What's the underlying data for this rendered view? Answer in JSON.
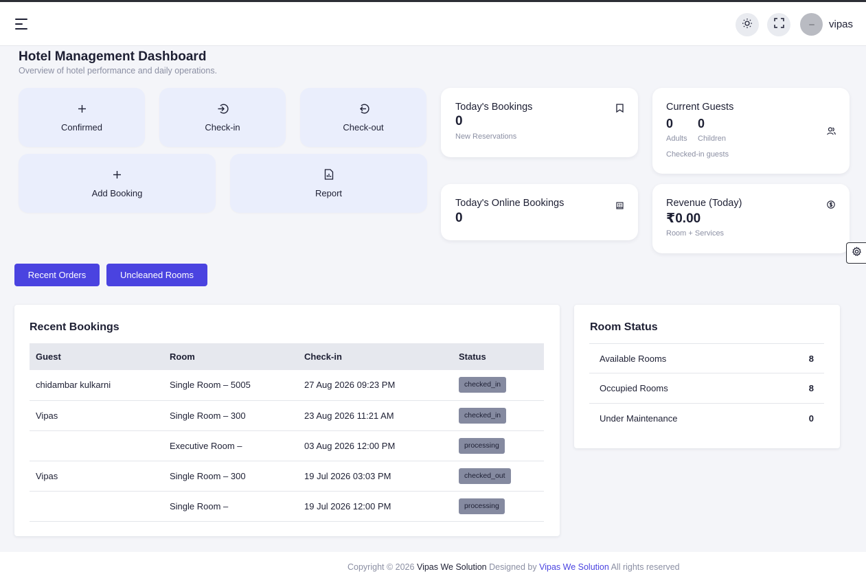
{
  "header": {
    "username": "vipas"
  },
  "page": {
    "title": "Hotel Management Dashboard",
    "subtitle": "Overview of hotel performance and daily operations."
  },
  "quick_actions": [
    {
      "label": "Confirmed",
      "icon": "plus-icon"
    },
    {
      "label": "Check-in",
      "icon": "login-icon"
    },
    {
      "label": "Check-out",
      "icon": "logout-icon"
    },
    {
      "label": "Add Booking",
      "icon": "plus-icon"
    },
    {
      "label": "Report",
      "icon": "report-icon"
    }
  ],
  "stats": {
    "todays_bookings": {
      "title": "Today's Bookings",
      "value": "0",
      "caption": "New Reservations",
      "icon": "bookmark-icon"
    },
    "current_guests": {
      "title": "Current Guests",
      "adults_value": "0",
      "adults_label": "Adults",
      "children_value": "0",
      "children_label": "Children",
      "caption": "Checked-in guests",
      "icon": "users-icon"
    },
    "online_bookings": {
      "title": "Today's Online Bookings",
      "value": "0",
      "icon": "building-icon"
    },
    "revenue": {
      "title": "Revenue (Today)",
      "value": "₹0.00",
      "caption": "Room + Services",
      "icon": "dollar-icon"
    }
  },
  "buttons": {
    "recent_orders": "Recent Orders",
    "uncleaned_rooms": "Uncleaned Rooms"
  },
  "recent_bookings": {
    "title": "Recent Bookings",
    "columns": [
      "Guest",
      "Room",
      "Check-in",
      "Status"
    ],
    "rows": [
      {
        "guest": "chidambar kulkarni",
        "room": "Single Room – 5005",
        "checkin": "27 Aug 2026 09:23 PM",
        "status": "checked_in"
      },
      {
        "guest": "Vipas",
        "room": "Single Room – 300",
        "checkin": "23 Aug 2026 11:21 AM",
        "status": "checked_in"
      },
      {
        "guest": "",
        "room": "Executive Room –",
        "checkin": "03 Aug 2026 12:00 PM",
        "status": "processing"
      },
      {
        "guest": "Vipas",
        "room": "Single Room – 300",
        "checkin": "19 Jul 2026 03:03 PM",
        "status": "checked_out"
      },
      {
        "guest": "",
        "room": "Single Room –",
        "checkin": "19 Jul 2026 12:00 PM",
        "status": "processing"
      }
    ]
  },
  "room_status": {
    "title": "Room Status",
    "rows": [
      {
        "label": "Available Rooms",
        "value": "8"
      },
      {
        "label": "Occupied Rooms",
        "value": "8"
      },
      {
        "label": "Under Maintenance",
        "value": "0"
      }
    ]
  },
  "footer": {
    "prefix": "Copyright © 2026",
    "company": "Vipas We Solution",
    "designed_by": "Designed by",
    "designer": "Vipas We Solution",
    "suffix": "All rights reserved"
  },
  "colors": {
    "primary": "#4a43e0",
    "quick_action_bg": "#eaeefc",
    "badge_bg": "#858aa0",
    "page_bg": "#f4f5f9"
  }
}
